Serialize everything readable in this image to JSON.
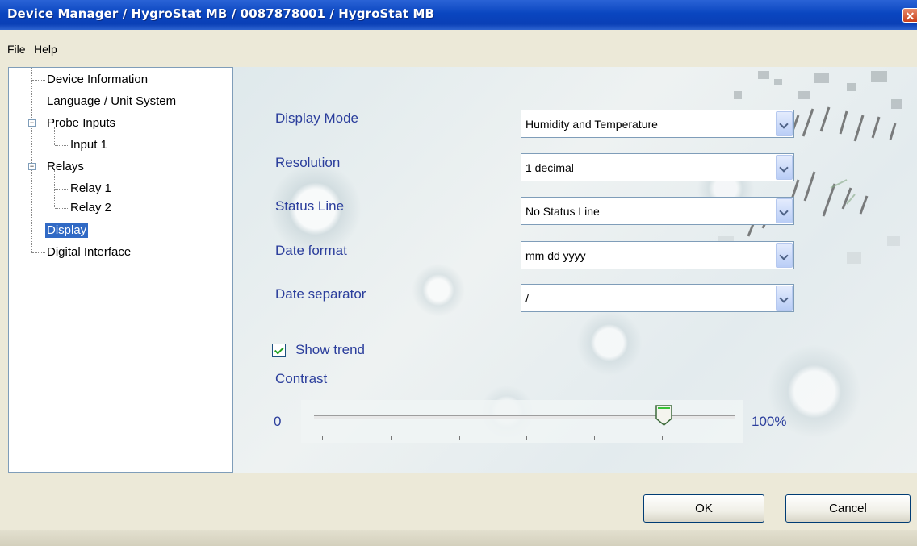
{
  "window": {
    "title": "Device Manager / HygroStat MB / 0087878001 / HygroStat MB",
    "close_glyph": "✕"
  },
  "menu": {
    "items": [
      {
        "label": "File"
      },
      {
        "label": "Help"
      }
    ]
  },
  "tree": {
    "items": [
      {
        "label": "Device Information",
        "level": 0,
        "selected": false
      },
      {
        "label": "Language / Unit System",
        "level": 0,
        "selected": false
      },
      {
        "label": "Probe Inputs",
        "level": 0,
        "expanded": true,
        "selected": false
      },
      {
        "label": "Input  1",
        "level": 1,
        "selected": false
      },
      {
        "label": "Relays",
        "level": 0,
        "expanded": true,
        "selected": false
      },
      {
        "label": "Relay 1",
        "level": 1,
        "selected": false
      },
      {
        "label": "Relay 2",
        "level": 1,
        "selected": false
      },
      {
        "label": "Display",
        "level": 0,
        "selected": true
      },
      {
        "label": "Digital Interface",
        "level": 0,
        "selected": false
      }
    ],
    "expander_glyph": "−"
  },
  "form": {
    "fields": [
      {
        "label": "Display Mode",
        "value": "Humidity and Temperature"
      },
      {
        "label": "Resolution",
        "value": "1 decimal"
      },
      {
        "label": "Status Line",
        "value": "No Status Line"
      },
      {
        "label": "Date format",
        "value": "mm dd yyyy"
      },
      {
        "label": "Date separator",
        "value": "/"
      }
    ],
    "show_trend": {
      "label": "Show trend",
      "checked": true
    },
    "contrast": {
      "label": "Contrast",
      "min_label": "0",
      "max_label": "100%",
      "value_percent": 83
    }
  },
  "buttons": {
    "ok": "OK",
    "cancel": "Cancel"
  },
  "colors": {
    "accent_label": "#2b3e9c",
    "selection": "#316ac5",
    "title_bar": "#0a46c0"
  }
}
